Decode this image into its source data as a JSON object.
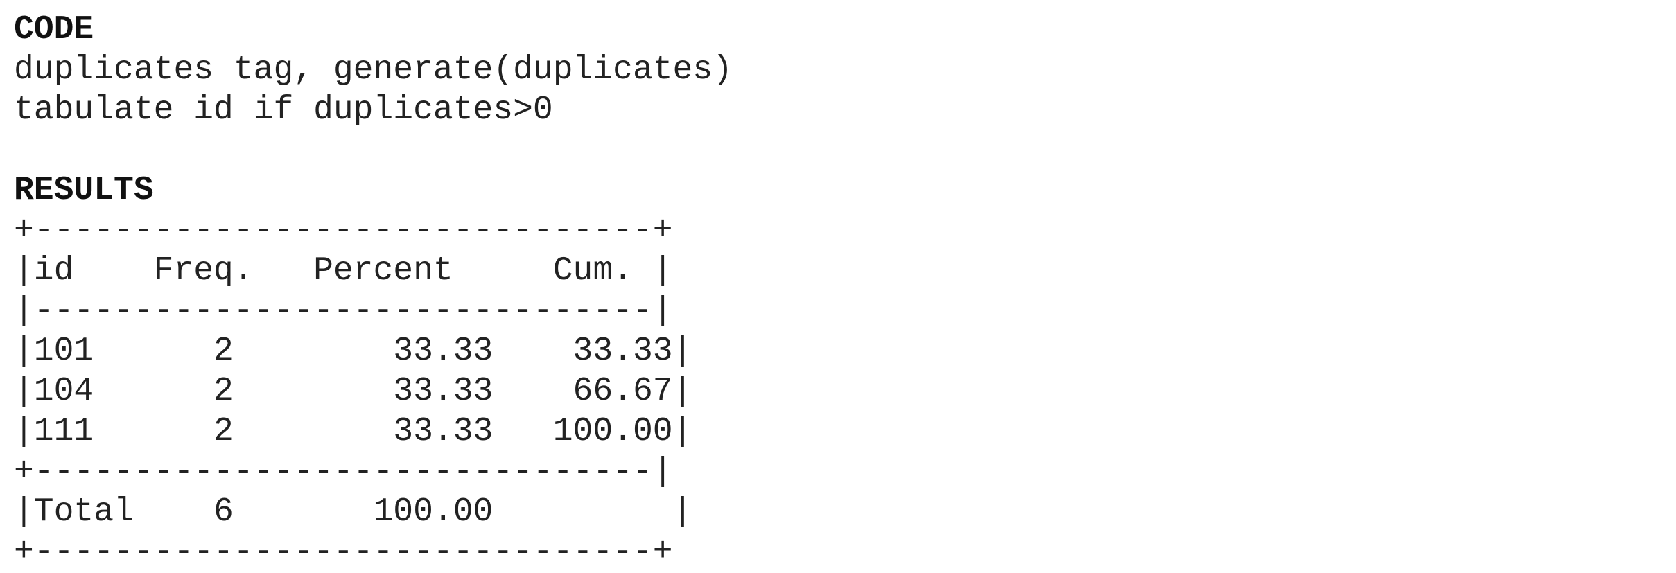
{
  "code_section": {
    "heading": "CODE",
    "lines": [
      "duplicates tag, generate(duplicates)",
      "tabulate id if duplicates>0"
    ]
  },
  "results_section": {
    "heading": "RESULTS",
    "table_lines": {
      "top_border": "+-------------------------------+",
      "header": "|id    Freq.   Percent     Cum. |",
      "separator": "|-------------------------------|",
      "rows": [
        "|101      2        33.33    33.33|",
        "|104      2        33.33    66.67|",
        "|111      2        33.33   100.00|"
      ],
      "total_border": "+-------------------------------|",
      "total": "|Total    6       100.00         |",
      "bottom_border": "+-------------------------------+"
    },
    "table": {
      "columns": [
        "id",
        "Freq.",
        "Percent",
        "Cum."
      ],
      "rows": [
        [
          "101",
          "2",
          "33.33",
          "33.33"
        ],
        [
          "104",
          "2",
          "33.33",
          "66.67"
        ],
        [
          "111",
          "2",
          "33.33",
          "100.00"
        ]
      ],
      "total": [
        "Total",
        "6",
        "100.00",
        ""
      ]
    }
  }
}
